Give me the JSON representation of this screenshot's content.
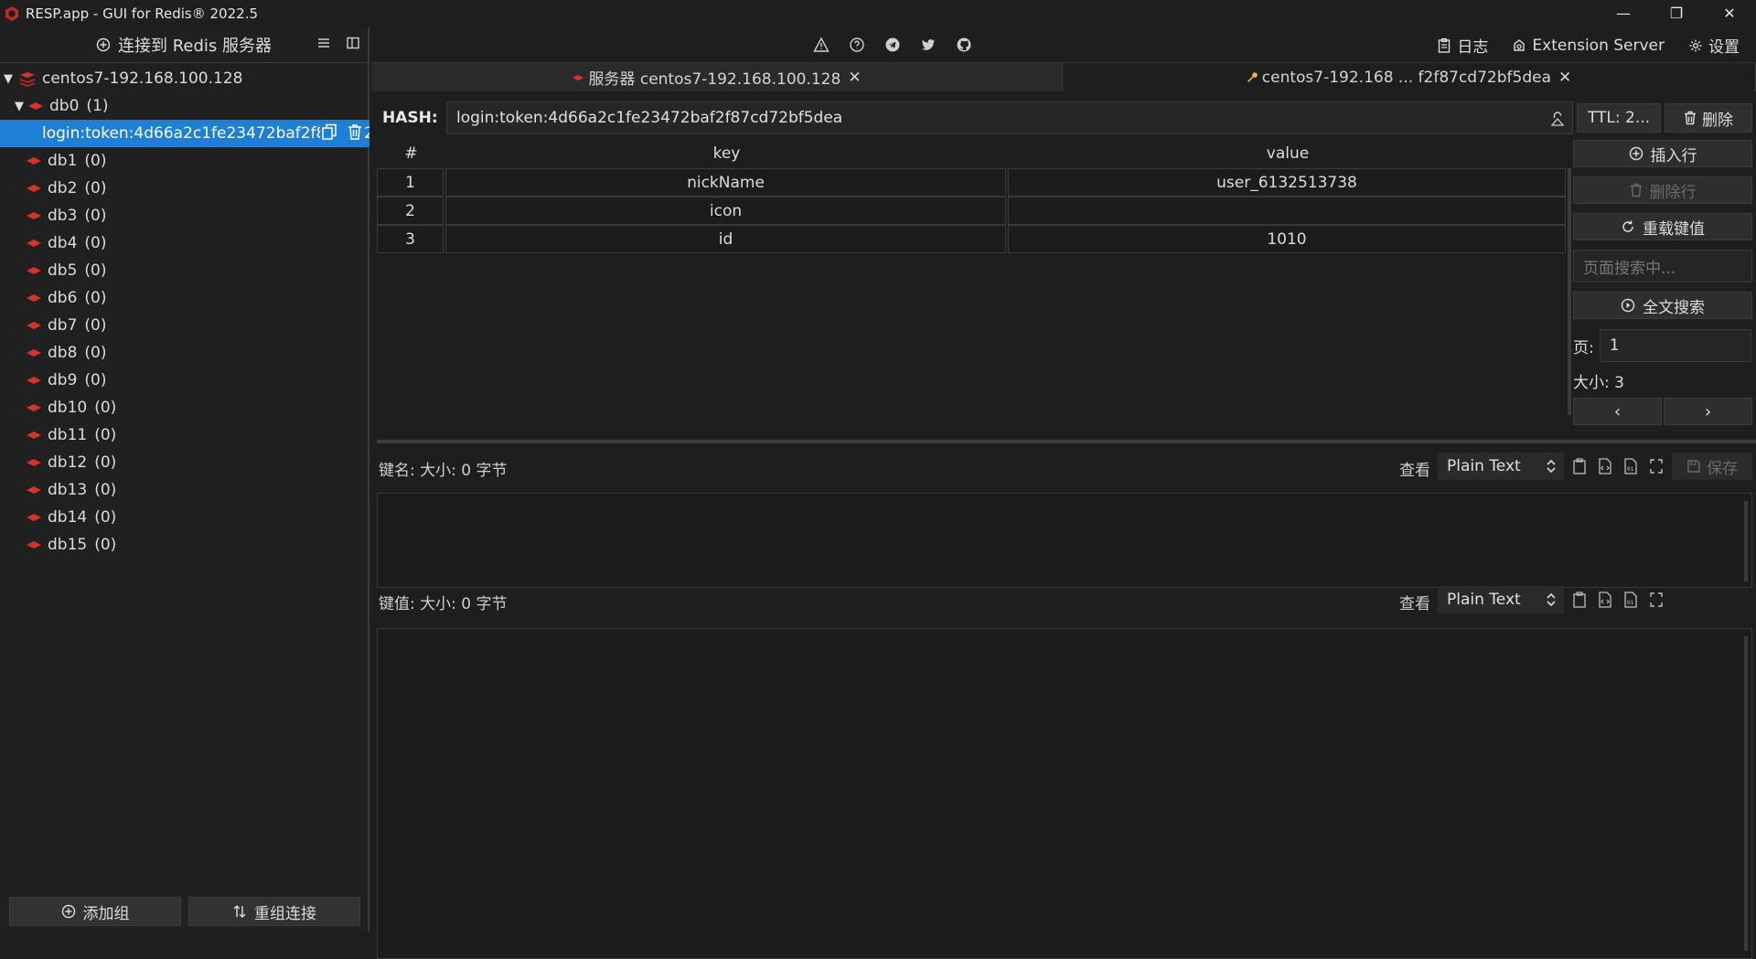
{
  "titlebar": {
    "title": "RESP.app - GUI for Redis® 2022.5",
    "logo_icon": "resp-logo-icon",
    "controls": [
      "minimize-icon",
      "restore-icon",
      "close-icon"
    ]
  },
  "sidebar": {
    "connect_label": "连接到 Redis 服务器",
    "server": {
      "name": "centos7-192.168.100.128"
    },
    "databases": [
      {
        "name": "db0",
        "count": "(1)"
      },
      {
        "name": "db1",
        "count": "(0)"
      },
      {
        "name": "db2",
        "count": "(0)"
      },
      {
        "name": "db3",
        "count": "(0)"
      },
      {
        "name": "db4",
        "count": "(0)"
      },
      {
        "name": "db5",
        "count": "(0)"
      },
      {
        "name": "db6",
        "count": "(0)"
      },
      {
        "name": "db7",
        "count": "(0)"
      },
      {
        "name": "db8",
        "count": "(0)"
      },
      {
        "name": "db9",
        "count": "(0)"
      },
      {
        "name": "db10",
        "count": "(0)"
      },
      {
        "name": "db11",
        "count": "(0)"
      },
      {
        "name": "db12",
        "count": "(0)"
      },
      {
        "name": "db13",
        "count": "(0)"
      },
      {
        "name": "db14",
        "count": "(0)"
      },
      {
        "name": "db15",
        "count": "(0)"
      }
    ],
    "selected_key": "login:token:4d66a2c1fe23472baf2f87cd72bf5dea",
    "add_group_label": "添加组",
    "reconnect_label": "重组连接"
  },
  "toolbar": {
    "center_icons": [
      "warning-icon",
      "help-icon",
      "telegram-icon",
      "twitter-icon",
      "github-icon"
    ],
    "log_label": "日志",
    "extension_label": "Extension Server",
    "settings_label": "设置"
  },
  "tabs": [
    {
      "label": "服务器 centos7-192.168.100.128",
      "active": false
    },
    {
      "label": "centos7-192.168 ... f2f87cd72bf5dea",
      "active": true
    }
  ],
  "key_view": {
    "type_label": "HASH:",
    "key_name": "login:token:4d66a2c1fe23472baf2f87cd72bf5dea",
    "ttl_label": "TTL: 2...",
    "delete_label": "删除",
    "columns": [
      "#",
      "key",
      "value"
    ],
    "rows": [
      {
        "num": "1",
        "key": "nickName",
        "value": "user_6132513738"
      },
      {
        "num": "2",
        "key": "icon",
        "value": ""
      },
      {
        "num": "3",
        "key": "id",
        "value": "1010"
      }
    ],
    "insert_row_label": "插入行",
    "delete_row_label": "删除行",
    "reload_label": "重载键值",
    "search_placeholder": "页面搜索中...",
    "fulltext_label": "全文搜索",
    "page_label": "页:",
    "page_value": "1",
    "size_label": "大小: 3",
    "prev_label": "‹",
    "next_label": "›"
  },
  "editors": {
    "key_editor_label": "键名:  大小: 0 字节",
    "value_editor_label": "键值: 大小: 0 字节",
    "view_label": "查看",
    "view_mode": "Plain Text",
    "save_label": "保存"
  },
  "colors": {
    "accent": "#1e7fd6",
    "redis_red": "#d8322a",
    "key_yellow": "#e8b13a"
  }
}
